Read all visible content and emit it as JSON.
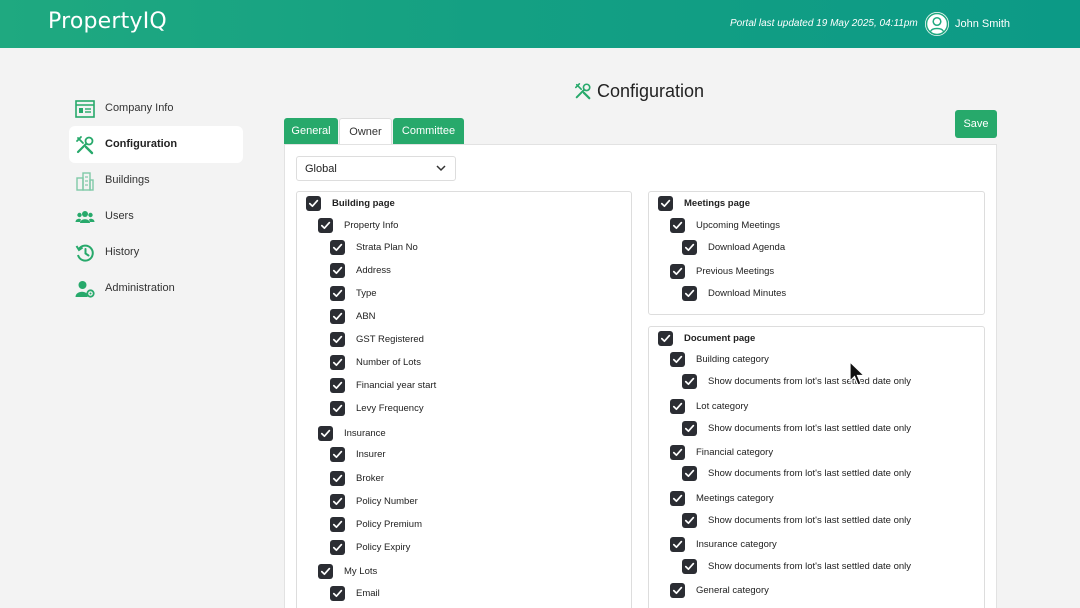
{
  "header": {
    "logo": "PropertyIQ",
    "updated": "Portal last updated 19 May 2025, 04:11pm",
    "user_name": "John Smith"
  },
  "sidebar": {
    "items": [
      {
        "label": "Company Info",
        "icon": "company-info-icon"
      },
      {
        "label": "Configuration",
        "icon": "tools-icon"
      },
      {
        "label": "Buildings",
        "icon": "buildings-icon"
      },
      {
        "label": "Users",
        "icon": "users-icon"
      },
      {
        "label": "History",
        "icon": "history-icon"
      },
      {
        "label": "Administration",
        "icon": "user-gear-icon"
      }
    ],
    "active": "Configuration"
  },
  "main": {
    "title": "Configuration",
    "tabs": [
      {
        "label": "General"
      },
      {
        "label": "Owner"
      },
      {
        "label": "Committee"
      }
    ],
    "active_tab": "Owner",
    "save_label": "Save",
    "scope_select": {
      "value": "Global"
    }
  },
  "building_page": {
    "label": "Building page",
    "items": [
      {
        "label": "Property Info",
        "level": 1
      },
      {
        "label": "Strata Plan No",
        "level": 2
      },
      {
        "label": "Address",
        "level": 2
      },
      {
        "label": "Type",
        "level": 2
      },
      {
        "label": "ABN",
        "level": 2
      },
      {
        "label": "GST Registered",
        "level": 2
      },
      {
        "label": "Number of Lots",
        "level": 2
      },
      {
        "label": "Financial year start",
        "level": 2
      },
      {
        "label": "Levy Frequency",
        "level": 2
      },
      {
        "label": "Insurance",
        "level": 1
      },
      {
        "label": "Insurer",
        "level": 2
      },
      {
        "label": "Broker",
        "level": 2
      },
      {
        "label": "Policy Number",
        "level": 2
      },
      {
        "label": "Policy Premium",
        "level": 2
      },
      {
        "label": "Policy Expiry",
        "level": 2
      },
      {
        "label": "My Lots",
        "level": 1
      },
      {
        "label": "Email",
        "level": 2
      }
    ]
  },
  "meetings_page": {
    "label": "Meetings page",
    "items": [
      {
        "label": "Upcoming Meetings",
        "level": 1
      },
      {
        "label": "Download Agenda",
        "level": 2
      },
      {
        "label": "Previous Meetings",
        "level": 1
      },
      {
        "label": "Download Minutes",
        "level": 2
      }
    ]
  },
  "document_page": {
    "label": "Document page",
    "items": [
      {
        "label": "Building category",
        "level": 1
      },
      {
        "label": "Show documents from lot's last settled date only",
        "level": 2
      },
      {
        "label": "Lot category",
        "level": 1
      },
      {
        "label": "Show documents from lot's last settled date only",
        "level": 2
      },
      {
        "label": "Financial category",
        "level": 1
      },
      {
        "label": "Show documents from lot's last settled date only",
        "level": 2
      },
      {
        "label": "Meetings category",
        "level": 1
      },
      {
        "label": "Show documents from lot's last settled date only",
        "level": 2
      },
      {
        "label": "Insurance category",
        "level": 1
      },
      {
        "label": "Show documents from lot's last settled date only",
        "level": 2
      },
      {
        "label": "General category",
        "level": 1
      }
    ]
  },
  "colors": {
    "brand_green": "#1fa980",
    "tab_green": "#27a96b",
    "checkbox": "#2b2d33"
  }
}
